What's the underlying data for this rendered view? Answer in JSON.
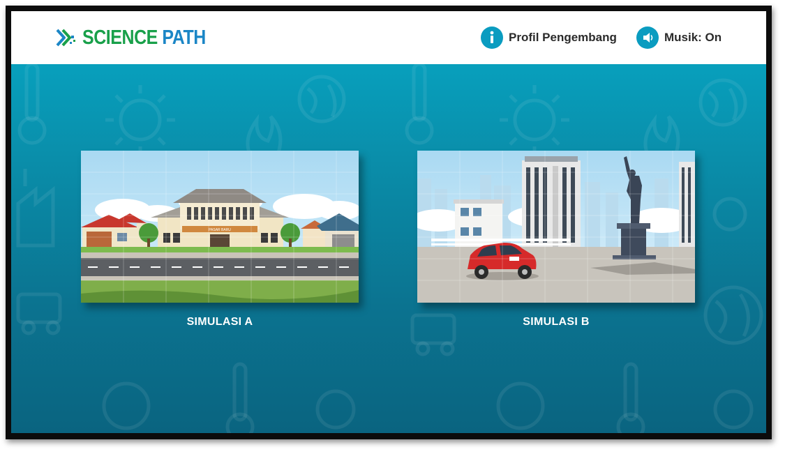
{
  "app": {
    "logo_word1": "SCIENCE",
    "logo_word2": "PATH"
  },
  "header": {
    "profile_label": "Profil Pengembang",
    "profile_icon": "info-icon",
    "music_label": "Musik: On",
    "music_icon": "speaker-icon"
  },
  "cards": [
    {
      "title": "SIMULASI A",
      "sign_text": "PASAR BARU"
    },
    {
      "title": "SIMULASI B"
    }
  ],
  "colors": {
    "accent": "#0a9cc0",
    "logo_green": "#19a04a",
    "logo_blue": "#1b86c6",
    "bg_top": "#06a9c7",
    "bg_bottom": "#0a6480"
  }
}
